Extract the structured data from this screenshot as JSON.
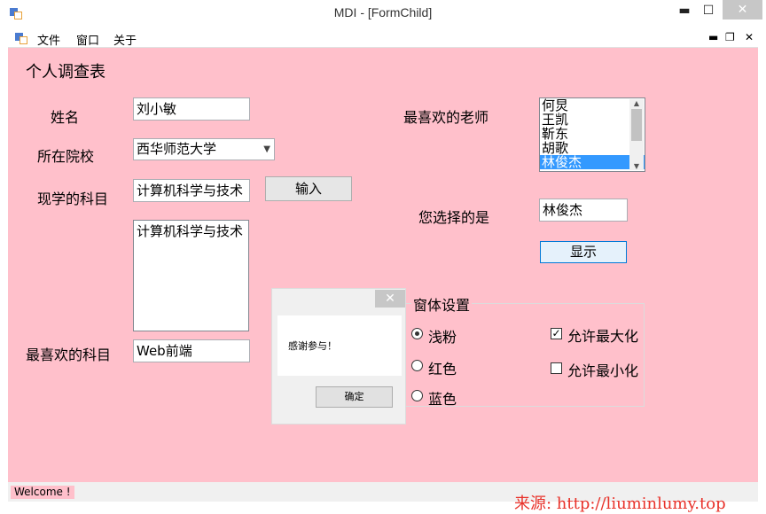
{
  "window": {
    "title": "MDI - [FormChild]",
    "min_glyph": "▬",
    "max_glyph": "☐",
    "close_glyph": "✕"
  },
  "menu": {
    "items": [
      "文件",
      "窗口",
      "关于"
    ],
    "mdi_min": "▬",
    "mdi_restore": "❐",
    "mdi_close": "✕"
  },
  "form": {
    "title": "个人调查表",
    "name_label": "姓名",
    "name_value": "刘小敏",
    "school_label": "所在院校",
    "school_value": "西华师范大学",
    "subject_label": "现学的科目",
    "subject_value": "计算机科学与技术",
    "input_button": "输入",
    "subjects_text": "计算机科学与技术",
    "fav_subject_label": "最喜欢的科目",
    "fav_subject_value": "Web前端",
    "teacher_label": "最喜欢的老师",
    "teachers": [
      "何炅",
      "王凯",
      "靳东",
      "胡歌",
      "林俊杰"
    ],
    "selected_teacher_index": 4,
    "chosen_label": "您选择的是",
    "chosen_value": "林俊杰",
    "show_button": "显示"
  },
  "settings": {
    "title": "窗体设置",
    "radios": [
      {
        "label": "浅粉",
        "checked": true
      },
      {
        "label": "红色",
        "checked": false
      },
      {
        "label": "蓝色",
        "checked": false
      }
    ],
    "checks": [
      {
        "label": "允许最大化",
        "checked": true
      },
      {
        "label": "允许最小化",
        "checked": false
      }
    ]
  },
  "dialog": {
    "message": "感谢参与！",
    "ok": "确定",
    "close_glyph": "✕"
  },
  "status": {
    "text": "Welcome !"
  },
  "watermark": "来源: http://liuminlumy.top",
  "colors": {
    "form_bg": "#ffc0cb",
    "selection": "#3399ff",
    "watermark": "#e8322a"
  }
}
